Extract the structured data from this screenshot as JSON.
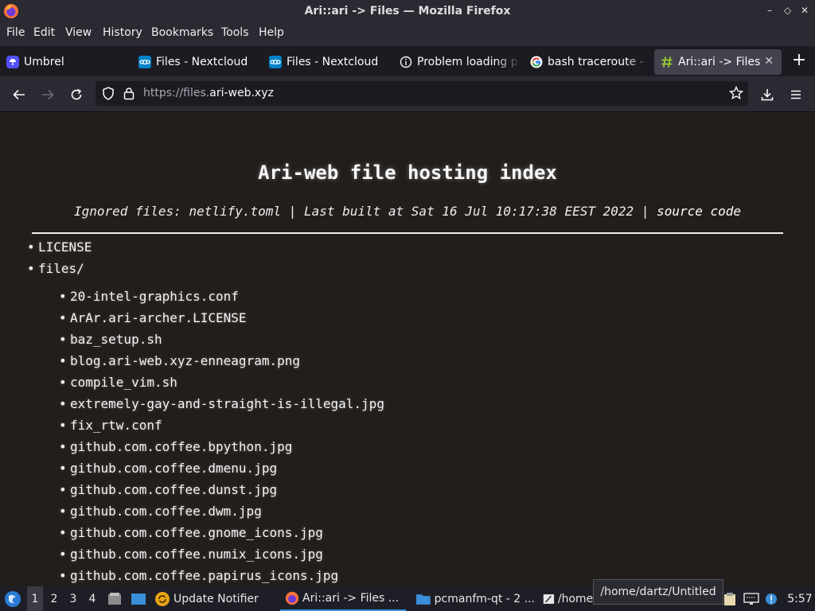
{
  "window": {
    "title": "Ari::ari -> Files — Mozilla Firefox",
    "controls": [
      "–",
      "◇",
      "✕"
    ]
  },
  "menu": [
    "File",
    "Edit",
    "View",
    "History",
    "Bookmarks",
    "Tools",
    "Help"
  ],
  "tabs": [
    {
      "label": "Umbrel",
      "icon": "umbrel-icon"
    },
    {
      "label": "Files - Nextcloud",
      "icon": "nextcloud-icon"
    },
    {
      "label": "Files - Nextcloud",
      "icon": "nextcloud-icon"
    },
    {
      "label": "Problem loading p",
      "icon": "info-icon"
    },
    {
      "label": "bash traceroute -",
      "icon": "google-icon"
    },
    {
      "label": "Ari::ari -> Files",
      "icon": "hash-icon",
      "active": true
    }
  ],
  "navbar": {
    "url_prefix": "https://files.",
    "url_domain": "ari-web.xyz"
  },
  "page": {
    "title": "Ari-web file hosting index",
    "subtitle_prefix": "Ignored files: netlify.toml | Last built at Sat 16 Jul 10:17:38 EEST 2022 |",
    "subtitle_link": "source code",
    "top_items": [
      "LICENSE",
      "files/"
    ],
    "files": [
      "20-intel-graphics.conf",
      "ArAr.ari-archer.LICENSE",
      "baz_setup.sh",
      "blog.ari-web.xyz-enneagram.png",
      "compile_vim.sh",
      "extremely-gay-and-straight-is-illegal.jpg",
      "fix_rtw.conf",
      "github.com.coffee.bpython.jpg",
      "github.com.coffee.dmenu.jpg",
      "github.com.coffee.dunst.jpg",
      "github.com.coffee.dwm.jpg",
      "github.com.coffee.gnome_icons.jpg",
      "github.com.coffee.numix_icons.jpg",
      "github.com.coffee.papirus_icons.jpg"
    ]
  },
  "taskbar": {
    "workspaces": [
      "1",
      "2",
      "3",
      "4"
    ],
    "items": [
      "Update Notifier",
      "Ari::ari -> Files ...",
      "pcmanfm-qt - 2 ...",
      "/home/"
    ],
    "tooltip": "/home/dartz/Untitled",
    "clock": "5:57"
  }
}
